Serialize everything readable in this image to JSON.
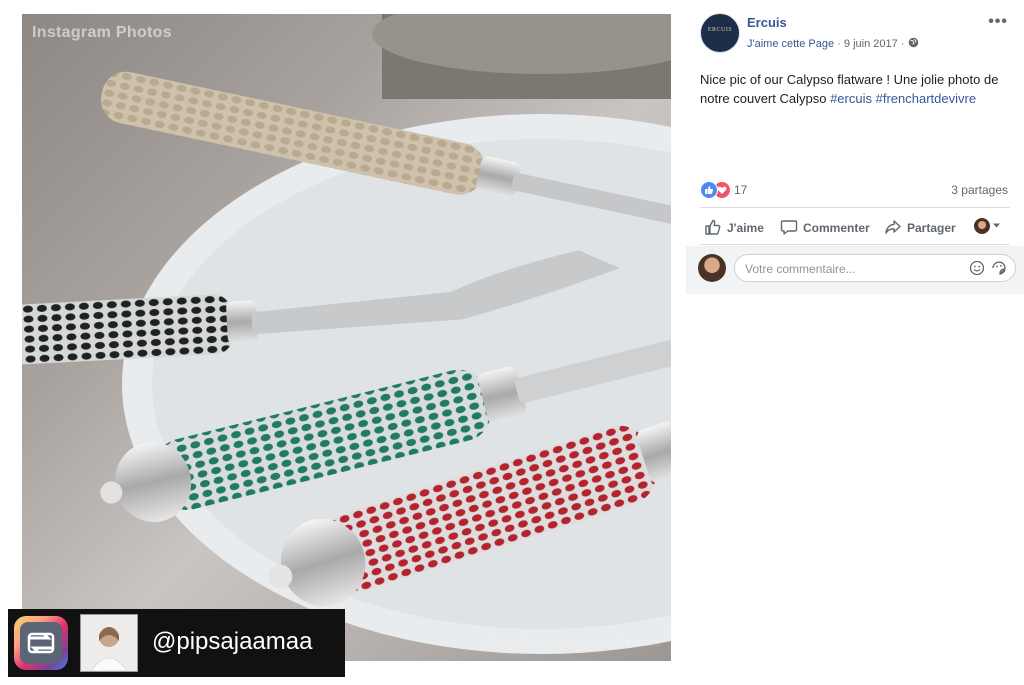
{
  "photo": {
    "watermark": "Instagram Photos",
    "shop_caption": "Christofle  ·  Boutique Saint-Germain"
  },
  "repost": {
    "handle": "@pipsajaamaa"
  },
  "post": {
    "page_name": "Ercuis",
    "logo_text": "ERCUIS",
    "like_page": "J'aime cette Page",
    "separator": "·",
    "date": "9 juin 2017",
    "separator2": "·",
    "more": "•••",
    "text_plain": "Nice pic of our Calypso flatware ! Une jolie photo de notre couvert Calypso ",
    "hashtags": [
      "#ercuis",
      "#frenchartdevivre"
    ],
    "reaction_count": "17",
    "shares": "3 partages",
    "actions": {
      "like": "J'aime",
      "comment": "Commenter",
      "share": "Partager"
    },
    "comment_placeholder": "Votre commentaire..."
  },
  "colors": {
    "link": "#385898",
    "like_blue": "#4d88f2",
    "love_red": "#f25268"
  }
}
